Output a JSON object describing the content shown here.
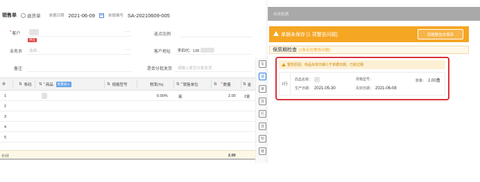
{
  "form": {
    "tab_active": "销售单",
    "tab_return": "退货单",
    "date_label": "单据日期",
    "date_value": "2021-06-09",
    "docno_label": "单据编号",
    "docno_value": "SA-20210609-005",
    "customer_label": "客户",
    "customer_tag": "供应",
    "dots": "···",
    "staff_label": "业务员",
    "staff_placeholder": "选择...",
    "discount_label": "返点比例",
    "address_label": "客户地址",
    "address_value": "李四代：138",
    "note_label": "备注",
    "allocate_label": "是否分批发货",
    "allocate_placeholder": "请输入是否分批发货"
  },
  "grid": {
    "headers": [
      "条码",
      "商品",
      "批量录入",
      "规格型号",
      "税率(%)",
      "销售单位",
      "数量",
      "金"
    ],
    "rows": [
      {
        "index": "1",
        "tax": "0.00%",
        "unit": "盒",
        "qty": "2.00",
        "amount": "2金"
      },
      {
        "index": "2"
      },
      {
        "index": "3"
      },
      {
        "index": "4"
      },
      {
        "index": "5"
      }
    ],
    "total_label": "小计",
    "total_qty": "2.00"
  },
  "side_tools": [
    "写",
    "清",
    "审",
    "改",
    "历",
    "流",
    "附",
    "链"
  ],
  "panel": {
    "header_text": "合法检测",
    "banner_text": "单据未保存 [1 项警告问题]",
    "banner_button": "忽略警告并保存",
    "section_title": "保质期检查",
    "section_count": "[1条存在警告问题]",
    "issue": {
      "reason": "警告原因：商品失效日期小于单据日期，已经过期",
      "index": "1行",
      "name_label": "商品名称：",
      "spec_label": "规格型号：",
      "qty_label": "数量：",
      "qty_value": "2.00盒",
      "prod_label": "生产日期：",
      "prod_value": "2021-05-30",
      "exp_label": "失效日期：",
      "exp_value": "2021-06-08"
    }
  },
  "colors": {
    "banner": "#f5a623",
    "alert_border": "#d9313b",
    "accent": "#2c7be5"
  }
}
